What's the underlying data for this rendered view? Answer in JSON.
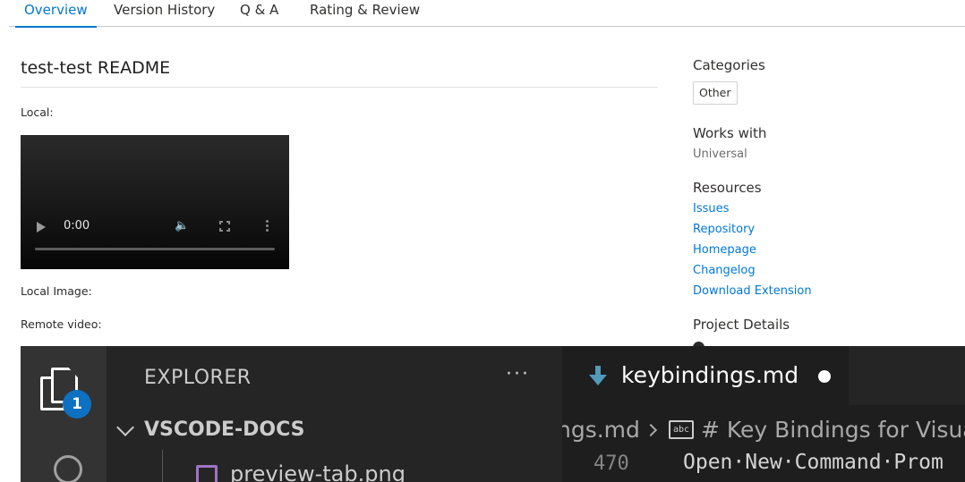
{
  "tabs": [
    {
      "label": "Overview",
      "active": true
    },
    {
      "label": "Version History",
      "active": false
    },
    {
      "label": "Q & A",
      "active": false
    },
    {
      "label": "Rating & Review",
      "active": false
    }
  ],
  "readme": {
    "title": "test-test README",
    "local_label": "Local:",
    "video": {
      "time": "0:00",
      "progress": 0
    },
    "local_image_label": "Local Image:",
    "remote_video_label": "Remote video:"
  },
  "sidebar": {
    "categories_heading": "Categories",
    "categories": [
      "Other"
    ],
    "works_with_heading": "Works with",
    "works_with": "Universal",
    "resources_heading": "Resources",
    "resources": [
      "Issues",
      "Repository",
      "Homepage",
      "Changelog",
      "Download Extension"
    ],
    "project_details_heading": "Project Details"
  },
  "vscode": {
    "explorer_title": "EXPLORER",
    "explorer_more": "···",
    "root_folder": "VSCODE-DOCS",
    "file_item": "preview-tab.png",
    "badge_count": "1",
    "active_tab": "keybindings.md",
    "breadcrumb_file": "ngs.md",
    "breadcrumb_symbol": "# Key Bindings for Visua",
    "abc_label": "abc",
    "line_number": "470",
    "code_text": "Open·New·Command·Prom",
    "colors": {
      "activity_bar": "#333333",
      "sidebar": "#252526",
      "editor": "#1e1e1e",
      "badge": "#0e70c0",
      "md_icon": "#519aba",
      "image_icon": "#a074c4"
    },
    "icons": [
      "files-icon",
      "search-icon",
      "markdown-file-icon",
      "image-file-icon",
      "abc-symbol-icon",
      "chevron-down-icon",
      "dirty-dot-icon"
    ]
  },
  "colors": {
    "accent": "#0078d4",
    "link": "#0078d4",
    "text": "#323130"
  }
}
